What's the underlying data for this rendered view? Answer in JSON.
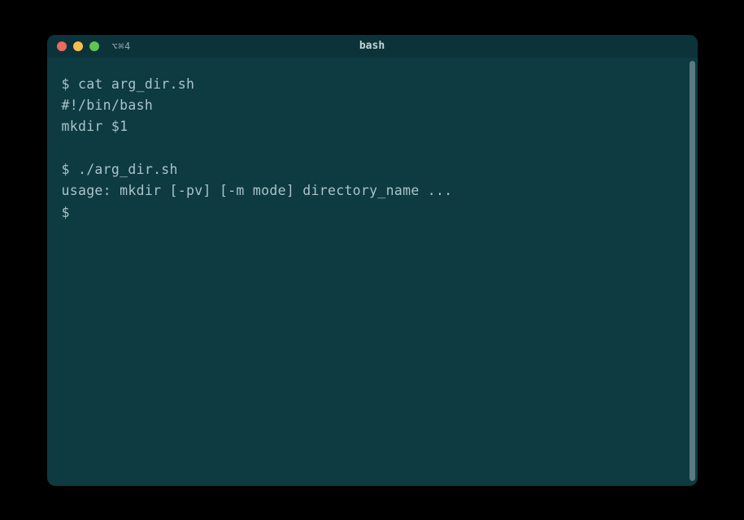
{
  "titlebar": {
    "tab_indicator": "⌥⌘4",
    "title": "bash"
  },
  "terminal": {
    "lines": [
      "$ cat arg_dir.sh",
      "#!/bin/bash",
      "mkdir $1",
      "",
      "$ ./arg_dir.sh",
      "usage: mkdir [-pv] [-m mode] directory_name ...",
      "$"
    ]
  }
}
